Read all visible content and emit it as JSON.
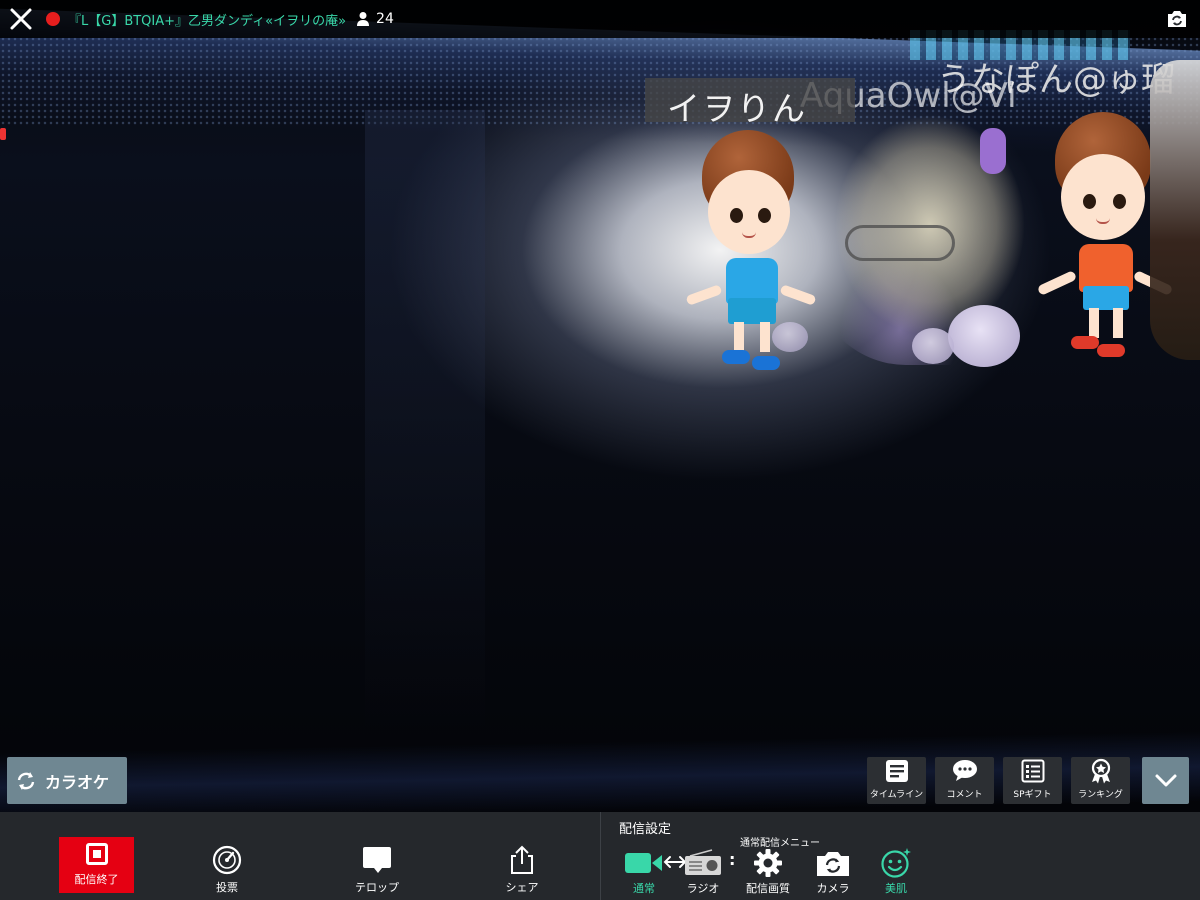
{
  "top_bar": {
    "room_title": "『L【G】BTQIA+』乙男ダンディ«イヲリの庵»",
    "viewer_count": "24"
  },
  "stage": {
    "name_labels": [
      "イヲりん",
      "AquaOwl@Vi",
      "うなぽん@ゅ瑠"
    ]
  },
  "overlay": {
    "karaoke_label": "カラオケ",
    "menu": [
      {
        "label": "タイムライン",
        "icon": "timeline-icon"
      },
      {
        "label": "コメント",
        "icon": "comment-icon"
      },
      {
        "label": "SPギフト",
        "icon": "sp-gift-icon"
      },
      {
        "label": "ランキング",
        "icon": "ranking-icon"
      }
    ]
  },
  "bottom_bar": {
    "end_label": "配信終了",
    "vote_label": "投票",
    "telop_label": "テロップ",
    "share_label": "シェア",
    "settings_title": "配信設定",
    "settings_sub": "通常配信メニュー",
    "normal_label": "通常",
    "radio_label": "ラジオ",
    "quality_label": "配信画質",
    "camera_label": "カメラ",
    "beauty_label": "美肌"
  },
  "colors": {
    "accent": "#39d7a9",
    "live_red": "#e61e1e",
    "end_red": "#e50012",
    "button_gray": "#6f8792",
    "menu_dark": "#2c2f33",
    "bar_bg": "#25282c"
  }
}
